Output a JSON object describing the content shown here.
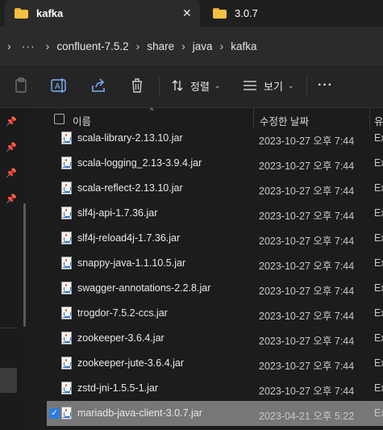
{
  "tabs": [
    {
      "label": "kafka",
      "active": true
    },
    {
      "label": "3.0.7",
      "active": false
    }
  ],
  "breadcrumb": {
    "more": "···",
    "items": [
      "confluent-7.5.2",
      "share",
      "java",
      "kafka"
    ]
  },
  "toolbar": {
    "sort_label": "정렬",
    "view_label": "보기",
    "more_label": "···"
  },
  "columns": {
    "name": "이름",
    "date": "수정한 날짜",
    "type": "유"
  },
  "files": [
    {
      "name": "scala-library-2.13.10.jar",
      "date": "2023-10-27 오후 7:44",
      "type": "Ex",
      "selected": false
    },
    {
      "name": "scala-logging_2.13-3.9.4.jar",
      "date": "2023-10-27 오후 7:44",
      "type": "Ex",
      "selected": false
    },
    {
      "name": "scala-reflect-2.13.10.jar",
      "date": "2023-10-27 오후 7:44",
      "type": "Ex",
      "selected": false
    },
    {
      "name": "slf4j-api-1.7.36.jar",
      "date": "2023-10-27 오후 7:44",
      "type": "Ex",
      "selected": false
    },
    {
      "name": "slf4j-reload4j-1.7.36.jar",
      "date": "2023-10-27 오후 7:44",
      "type": "Ex",
      "selected": false
    },
    {
      "name": "snappy-java-1.1.10.5.jar",
      "date": "2023-10-27 오후 7:44",
      "type": "Ex",
      "selected": false
    },
    {
      "name": "swagger-annotations-2.2.8.jar",
      "date": "2023-10-27 오후 7:44",
      "type": "Ex",
      "selected": false
    },
    {
      "name": "trogdor-7.5.2-ccs.jar",
      "date": "2023-10-27 오후 7:44",
      "type": "Ex",
      "selected": false
    },
    {
      "name": "zookeeper-3.6.4.jar",
      "date": "2023-10-27 오후 7:44",
      "type": "Ex",
      "selected": false
    },
    {
      "name": "zookeeper-jute-3.6.4.jar",
      "date": "2023-10-27 오후 7:44",
      "type": "Ex",
      "selected": false
    },
    {
      "name": "zstd-jni-1.5.5-1.jar",
      "date": "2023-10-27 오후 7:44",
      "type": "Ex",
      "selected": false
    },
    {
      "name": "mariadb-java-client-3.0.7.jar",
      "date": "2023-04-21 오후 5:22",
      "type": "Ex",
      "selected": true
    }
  ],
  "colors": {
    "background": "#1c1c1c",
    "selection": "#777777",
    "folder": "#f5c042",
    "checkbox_accent": "#2d7be0"
  }
}
